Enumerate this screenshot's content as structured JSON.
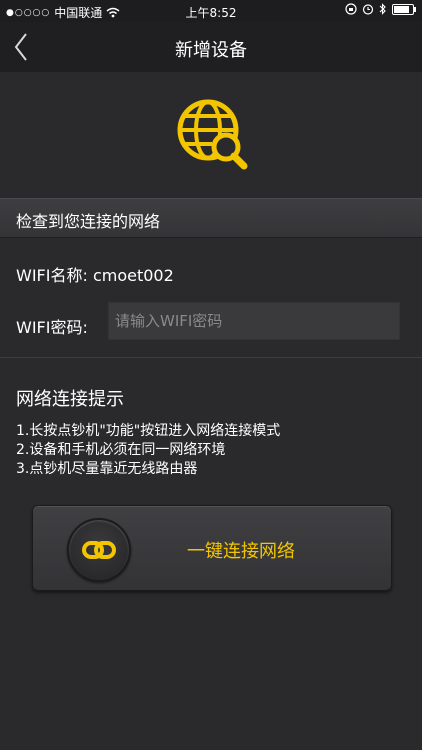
{
  "status_bar": {
    "carrier": "中国联通",
    "time": "上午8:52"
  },
  "nav": {
    "title": "新增设备"
  },
  "section": {
    "heading": "检查到您连接的网络"
  },
  "wifi": {
    "name_line": "WIFI名称: cmoet002",
    "password_label": "WIFI密码:",
    "password_value": "",
    "password_placeholder": "请输入WIFI密码"
  },
  "tips": {
    "title": "网络连接提示",
    "items": [
      "1.长按点钞机\"功能\"按钮进入网络连接模式",
      "2.设备和手机必须在同一网络环境",
      "3.点钞机尽量靠近无线路由器"
    ]
  },
  "connect_button": {
    "label": "一键连接网络"
  },
  "colors": {
    "accent": "#f2c500",
    "background": "#2a2a2c",
    "navbar": "#1f1f21"
  },
  "icons": {
    "back": "chevron-left-icon",
    "globe_search": "globe-search-icon",
    "link": "link-icon",
    "wifi": "wifi-icon",
    "battery": "battery-icon"
  },
  "battery_level": 0.85
}
